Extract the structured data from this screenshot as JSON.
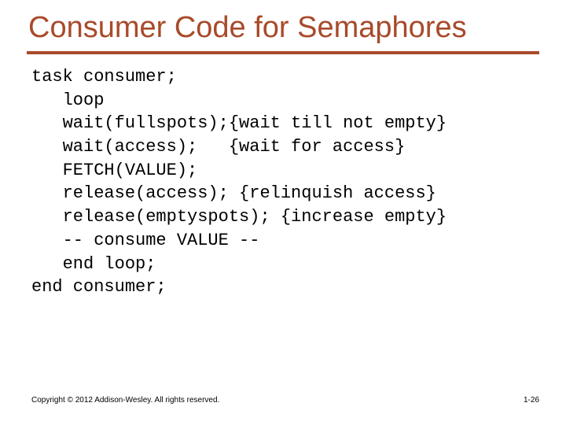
{
  "title": "Consumer Code for Semaphores",
  "code": {
    "l1": "task consumer;",
    "l2": "   loop",
    "l3": "   wait(fullspots);{wait till not empty}",
    "l4": "   wait(access);   {wait for access}",
    "l5": "   FETCH(VALUE);",
    "l6": "   release(access); {relinquish access}",
    "l7": "   release(emptyspots); {increase empty}",
    "l8": "   -- consume VALUE --",
    "l9": "   end loop;",
    "l10": "end consumer;"
  },
  "footer": "Copyright © 2012 Addison-Wesley. All rights reserved.",
  "pagenum": "1-26"
}
